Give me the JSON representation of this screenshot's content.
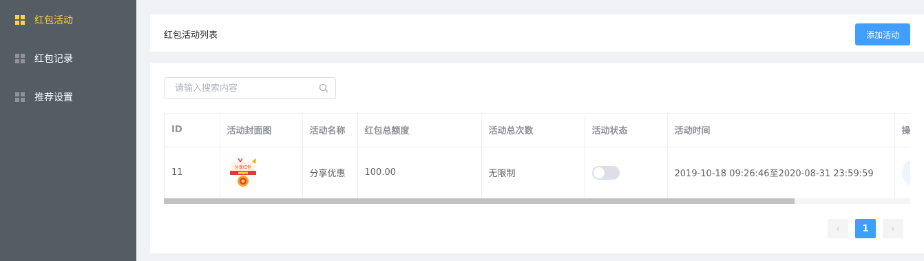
{
  "sidebar": {
    "items": [
      {
        "label": "红包活动",
        "icon": "grid-icon",
        "active": true
      },
      {
        "label": "红包记录",
        "icon": "grid-icon",
        "active": false
      },
      {
        "label": "推荐设置",
        "icon": "grid-icon",
        "active": false
      }
    ],
    "active_color": "#ffd04b",
    "background": "#545c64"
  },
  "header": {
    "title": "红包活动列表",
    "add_button": "添加活动"
  },
  "search": {
    "placeholder": "请输入搜索内容",
    "value": ""
  },
  "table": {
    "columns": [
      "ID",
      "活动封面图",
      "活动名称",
      "红包总额度",
      "活动总次数",
      "活动状态",
      "活动时间",
      "操"
    ],
    "rows": [
      {
        "id": "11",
        "cover_icon": "red-envelope-cover-image",
        "cover_text": "分享红包",
        "name": "分享优惠",
        "total_amount": "100.00",
        "total_times": "无限制",
        "status_on": false,
        "time": "2019-10-18 09:26:46至2020-08-31 23:59:59"
      }
    ]
  },
  "pagination": {
    "prev": "‹",
    "current": "1",
    "next": "›"
  },
  "colors": {
    "primary": "#409eff"
  }
}
